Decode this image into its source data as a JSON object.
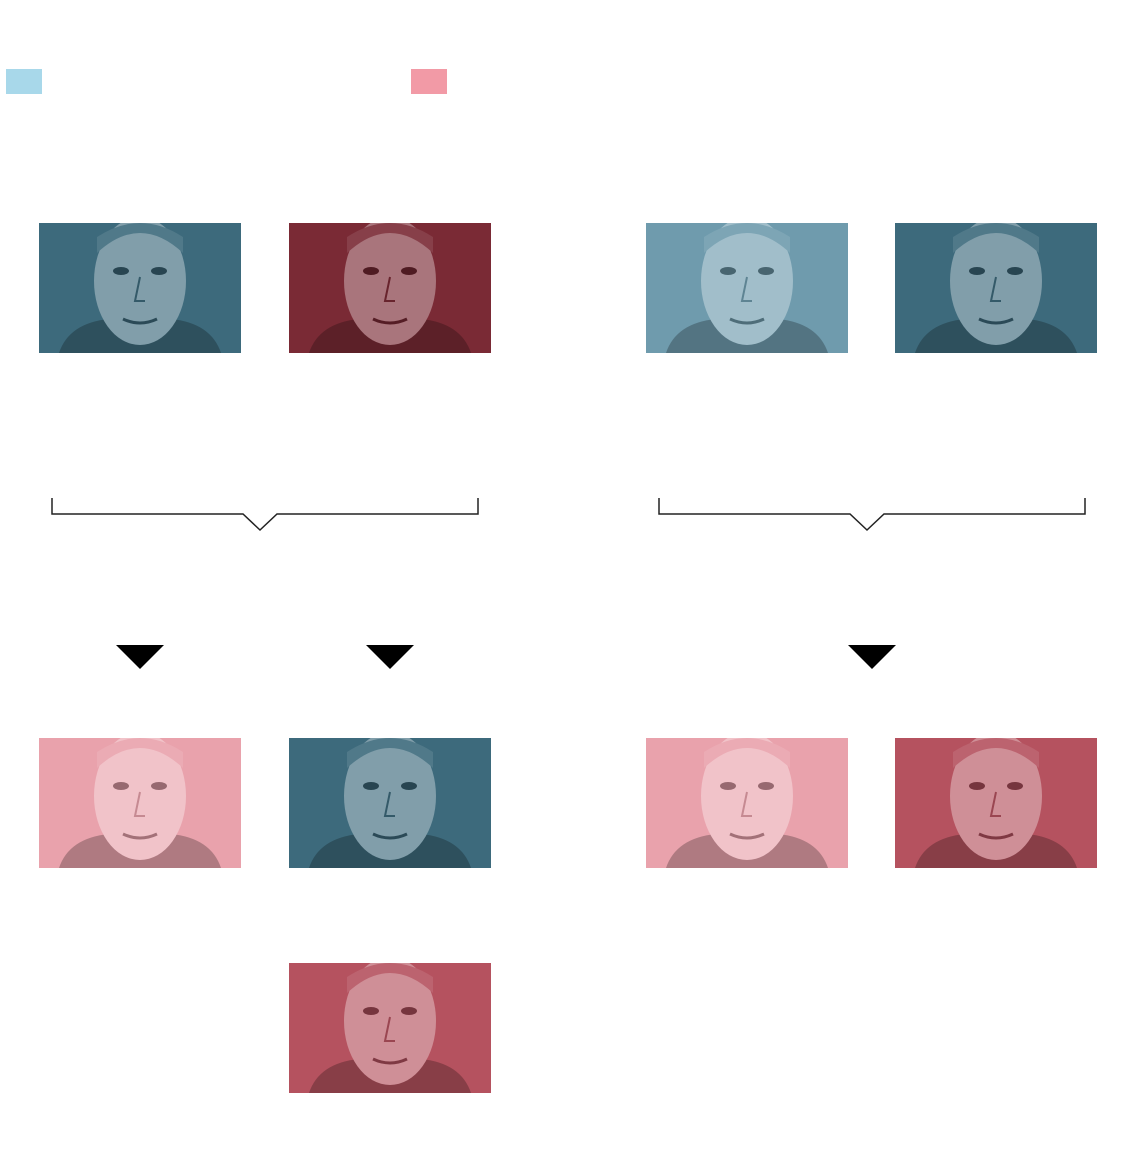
{
  "colors": {
    "blue_swatch": "#a8d8ea",
    "red_swatch": "#f29aa6",
    "blue_dark": "#3d6a7c",
    "blue_mid": "#6f9bad",
    "blue_light": "#9fc3d3",
    "red_dark": "#7a2a35",
    "red_mid": "#b5525f",
    "red_light": "#e9a2ac",
    "bracket": "#222222",
    "arrow": "#000000"
  },
  "legend": [
    {
      "swatch": "blue_swatch"
    },
    {
      "swatch": "red_swatch"
    }
  ],
  "groups": [
    {
      "before": [
        {
          "party": "blue",
          "tone": "dark"
        },
        {
          "party": "red",
          "tone": "dark"
        }
      ],
      "after": [
        {
          "party": "red",
          "tone": "light"
        },
        {
          "party": "blue",
          "tone": "dark"
        },
        {
          "party": "red",
          "tone": "mid"
        }
      ]
    },
    {
      "before": [
        {
          "party": "blue",
          "tone": "mid"
        },
        {
          "party": "blue",
          "tone": "dark"
        }
      ],
      "after": [
        {
          "party": "red",
          "tone": "light"
        },
        {
          "party": "red",
          "tone": "mid"
        }
      ]
    }
  ]
}
